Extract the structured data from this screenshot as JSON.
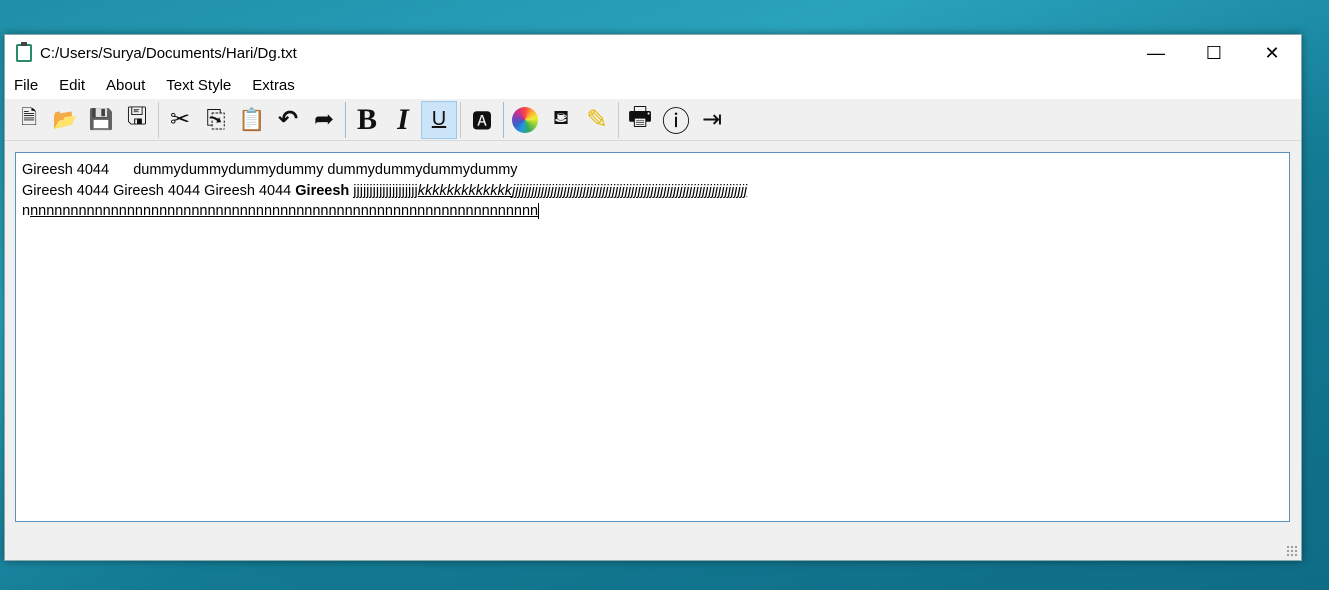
{
  "window": {
    "title": "C:/Users/Surya/Documents/Hari/Dg.txt",
    "minimize": "—",
    "maximize": "☐",
    "close": "✕"
  },
  "menu": [
    "File",
    "Edit",
    "About",
    "Text Style",
    "Extras"
  ],
  "toolbar": [
    {
      "name": "new-file",
      "glyph": "🗎"
    },
    {
      "name": "open-file",
      "glyph": "📂"
    },
    {
      "name": "save",
      "glyph": "💾"
    },
    {
      "name": "save-as",
      "glyph": "🖫"
    },
    {
      "name": "cut",
      "glyph": "✂"
    },
    {
      "name": "copy",
      "glyph": "⎘"
    },
    {
      "name": "paste",
      "glyph": "📋"
    },
    {
      "name": "undo",
      "glyph": "↶"
    },
    {
      "name": "redo",
      "glyph": "➦"
    },
    {
      "name": "bold",
      "glyph": "B"
    },
    {
      "name": "italic",
      "glyph": "I"
    },
    {
      "name": "underline",
      "glyph": "U"
    },
    {
      "name": "font",
      "glyph": "🅰"
    },
    {
      "name": "color",
      "glyph": "●"
    },
    {
      "name": "fill",
      "glyph": "⛾"
    },
    {
      "name": "highlight",
      "glyph": "✎"
    },
    {
      "name": "print",
      "glyph": "🖶"
    },
    {
      "name": "info",
      "glyph": "ⓘ"
    },
    {
      "name": "exit",
      "glyph": "⇥"
    }
  ],
  "document": {
    "line1": "Gireesh 4044      dummydummydummydummy dummydummydummydummy",
    "line2_plain": "Gireesh 4044 Gireesh 4044 Gireesh 4044 ",
    "line2_bold": "Gireesh",
    "line2_space": " ",
    "line2_underline": "jjjjjjjjjjjjjjjjjjjj",
    "line2_italic_k": "kkkkkkkkkkkkk",
    "line2_italic_j": "jjjjjjjjjjjjjjjjjjjjjjjjjjjjjjjjjjjjjjjjjjjjjjjjjjjjjjjjjjjjjjjjjjjjjjjjj",
    "line3_plain": "n",
    "line3_underline": "nnnnnnnnnnnnnnnnnnnnnnnnnnnnnnnnnnnnnnnnnnnnnnnnnnnnnnnnnnnnnnn"
  }
}
